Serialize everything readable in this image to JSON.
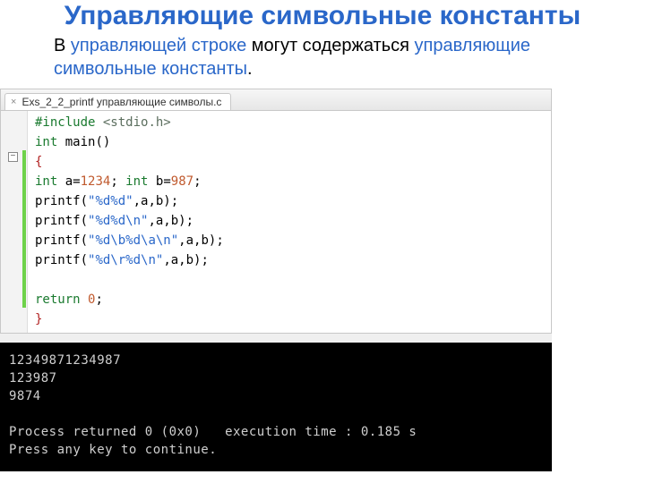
{
  "title": "Управляющие символьные константы",
  "body": {
    "pre1": "В ",
    "hl1": "управляющей строке",
    "pre2": " могут содержаться ",
    "hl2": "управляющие символьные константы",
    "post": "."
  },
  "editor": {
    "tab": {
      "close_glyph": "×",
      "label": "Exs_2_2_printf управляющие символы.c"
    },
    "fold_glyph": "−",
    "code": {
      "l1_kw": "#include",
      "l1_inc": " <stdio.h>",
      "l2_kw": "int",
      "l2_rest": " main()",
      "l3": "{",
      "l4a_kw": "int",
      "l4a_rest": " a=",
      "l4a_num": "1234",
      "l4a_semi": ";",
      "l4b_kw": " int",
      "l4b_rest": " b=",
      "l4b_num": "987",
      "l4b_semi": ";",
      "l5_call": "printf(",
      "l5_str": "\"%d%d\"",
      "l5_rest": ",a,b);",
      "l6_call": "printf(",
      "l6_str": "\"%d%d\\n\"",
      "l6_rest": ",a,b);",
      "l7_call": "printf(",
      "l7_str": "\"%d\\b%d\\a\\n\"",
      "l7_rest": ",a,b);",
      "l8_call": "printf(",
      "l8_str": "\"%d\\r%d\\n\"",
      "l8_rest": ",a,b);",
      "l10_kw": "return",
      "l10_rest": " ",
      "l10_num": "0",
      "l10_semi": ";",
      "l11": "}"
    }
  },
  "console": {
    "out1": "12349871234987",
    "out2": "123987",
    "out3": "9874",
    "status": "Process returned 0 (0x0)   execution time : 0.185 s",
    "prompt": "Press any key to continue."
  }
}
